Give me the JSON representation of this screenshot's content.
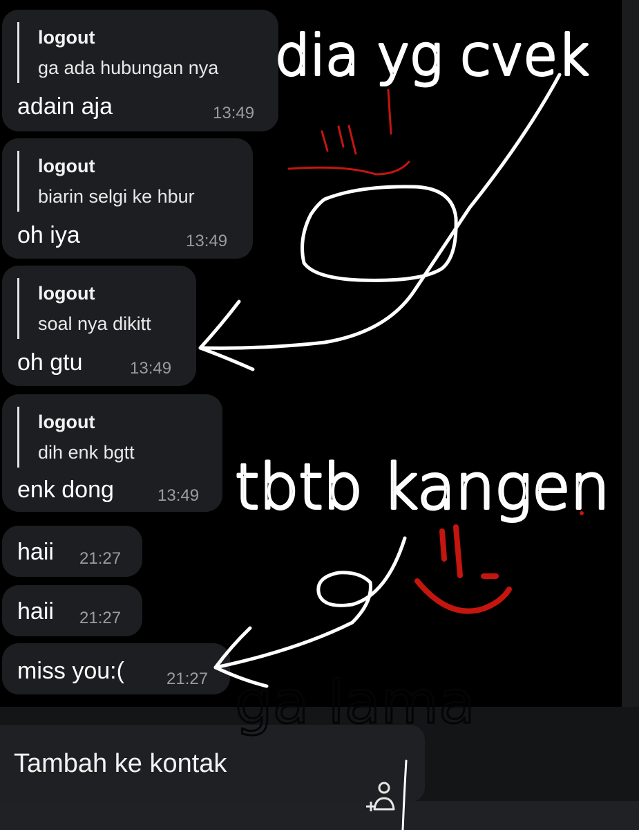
{
  "messages": [
    {
      "reply_name": "logout",
      "reply_text": "ga ada hubungan nya",
      "text": "adain aja",
      "time": "13:49"
    },
    {
      "reply_name": "logout",
      "reply_text": "biarin selgi ke hbur",
      "text": "oh iya",
      "time": "13:49"
    },
    {
      "reply_name": "logout",
      "reply_text": "soal nya dikitt",
      "text": "oh gtu",
      "time": "13:49"
    },
    {
      "reply_name": "logout",
      "reply_text": "dih enk bgtt",
      "text": "enk dong",
      "time": "13:49"
    },
    {
      "text": "haii",
      "time": "21:27"
    },
    {
      "text": "haii",
      "time": "21:27"
    },
    {
      "text": "miss you:(",
      "time": "21:27"
    }
  ],
  "input_bar": {
    "label": "Tambah ke kontak",
    "icon": "add-contact-icon"
  },
  "annotations": {
    "top": "dia yg cvek",
    "middle": "tbtb kangen",
    "hidden": "ga lama",
    "ink_color": "#ffffff",
    "accent_color": "#c4160e"
  }
}
